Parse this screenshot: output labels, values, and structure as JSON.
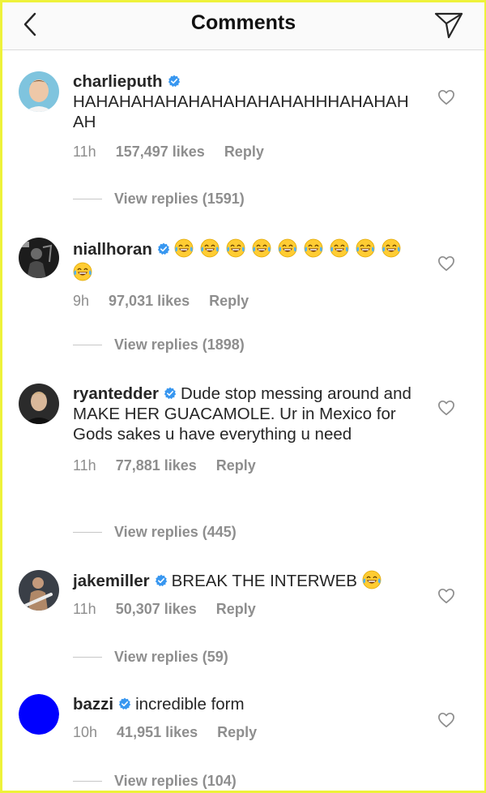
{
  "header": {
    "title": "Comments",
    "back_icon": "chevron-left-icon",
    "send_icon": "paper-plane-icon"
  },
  "colors": {
    "verified": "#3897f0",
    "muted": "#8e8e8e",
    "text": "#262626",
    "bazzi_avatar": "#0000ff"
  },
  "comments": [
    {
      "username": "charlieputh",
      "text": "HAHAHAHAHAHAHAHAHAHAHHHAHAHAHAH",
      "time": "11h",
      "likes": "157,497 likes",
      "reply": "Reply",
      "view_replies": "View replies (1591)"
    },
    {
      "username": "niallhoran",
      "text": "😂😂😂😂😂😂😂😂😂😂",
      "time": "9h",
      "likes": "97,031 likes",
      "reply": "Reply",
      "view_replies": "View replies (1898)"
    },
    {
      "username": "ryantedder",
      "text": "Dude stop messing around and MAKE HER GUACAMOLE.  Ur in Mexico for Gods sakes u have everything u need",
      "time": "11h",
      "likes": "77,881 likes",
      "reply": "Reply",
      "view_replies": "View replies (445)"
    },
    {
      "username": "jakemiller",
      "text": "BREAK THE INTERWEB 😂",
      "time": "11h",
      "likes": "50,307 likes",
      "reply": "Reply",
      "view_replies": "View replies (59)"
    },
    {
      "username": "bazzi",
      "text": "incredible form",
      "time": "10h",
      "likes": "41,951 likes",
      "reply": "Reply",
      "view_replies": "View replies (104)"
    }
  ]
}
